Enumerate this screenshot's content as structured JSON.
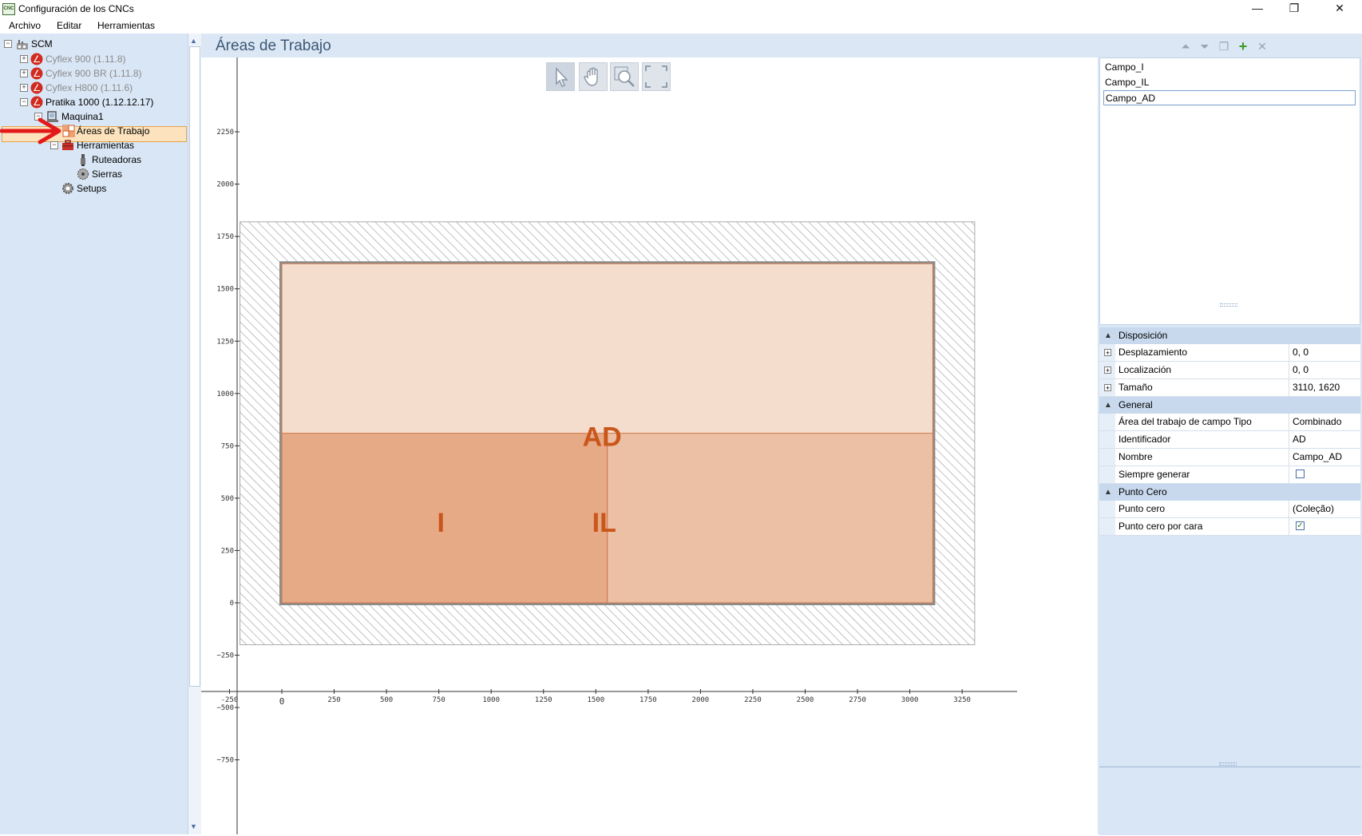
{
  "window": {
    "title": "Configuración de los CNCs",
    "app_icon_text": "CNC",
    "minimize_glyph": "—",
    "restore_glyph": "❐",
    "close_glyph": "✕"
  },
  "menu": [
    "Archivo",
    "Editar",
    "Herramientas"
  ],
  "tree": {
    "root": "SCM",
    "machines": [
      {
        "label": "Cyflex 900 (1.11.8)",
        "disabled": true
      },
      {
        "label": "Cyflex 900 BR (1.11.8)",
        "disabled": true
      },
      {
        "label": "Cyflex H800 (1.11.6)",
        "disabled": true
      },
      {
        "label": "Pratika 1000 (1.12.12.17)",
        "disabled": false
      }
    ],
    "maquina": "Maquina1",
    "areas": "Áreas de Trabajo",
    "herramientas": "Herramientas",
    "ruteadoras": "Ruteadoras",
    "sierras": "Sierras",
    "setups": "Setups"
  },
  "center": {
    "title": "Áreas de Trabajo",
    "header_icons": [
      "move-up-icon",
      "move-down-icon",
      "copy-icon",
      "add-icon",
      "delete-icon"
    ]
  },
  "chart_data": {
    "type": "workspace-layout",
    "x_ticks": [
      -250,
      0,
      250,
      500,
      750,
      1000,
      1250,
      1500,
      1750,
      2000,
      2250,
      2500,
      2750,
      3000,
      3250
    ],
    "y_ticks": [
      2250,
      2000,
      1750,
      1500,
      1250,
      1000,
      750,
      500,
      250,
      0,
      -250,
      -500,
      -750
    ],
    "machine_extent": {
      "x": [
        -200,
        3310
      ],
      "y": [
        -200,
        1820
      ]
    },
    "table_extent": {
      "x": [
        0,
        3110
      ],
      "y": [
        0,
        1620
      ]
    },
    "fields": [
      {
        "id": "AD",
        "x": [
          0,
          3110
        ],
        "y": [
          0,
          1620
        ],
        "color": "#f4ddcd"
      },
      {
        "id": "I",
        "x": [
          0,
          1555
        ],
        "y": [
          0,
          810
        ],
        "color": "#e6aa87"
      },
      {
        "id": "IL",
        "x": [
          1555,
          3110
        ],
        "y": [
          0,
          810
        ],
        "color": "#ecc0a4"
      }
    ],
    "label_color": "#c9561b"
  },
  "fields": [
    "Campo_I",
    "Campo_IL",
    "Campo_AD"
  ],
  "properties": [
    {
      "category": "Disposición",
      "rows": [
        {
          "name": "Desplazamiento",
          "value": "0, 0",
          "expand": true
        },
        {
          "name": "Localización",
          "value": "0, 0",
          "expand": true
        },
        {
          "name": "Tamaño",
          "value": "3110, 1620",
          "expand": true
        }
      ]
    },
    {
      "category": "General",
      "rows": [
        {
          "name": "Área del trabajo de campo Tipo",
          "value": "Combinado"
        },
        {
          "name": "Identificador",
          "value": "AD"
        },
        {
          "name": "Nombre",
          "value": "Campo_AD"
        },
        {
          "name": "Siempre generar",
          "checkbox": false
        }
      ]
    },
    {
      "category": "Punto Cero",
      "rows": [
        {
          "name": "Punto cero",
          "value": "(Coleção)"
        },
        {
          "name": "Punto cero por cara",
          "checkbox": true
        }
      ]
    }
  ]
}
